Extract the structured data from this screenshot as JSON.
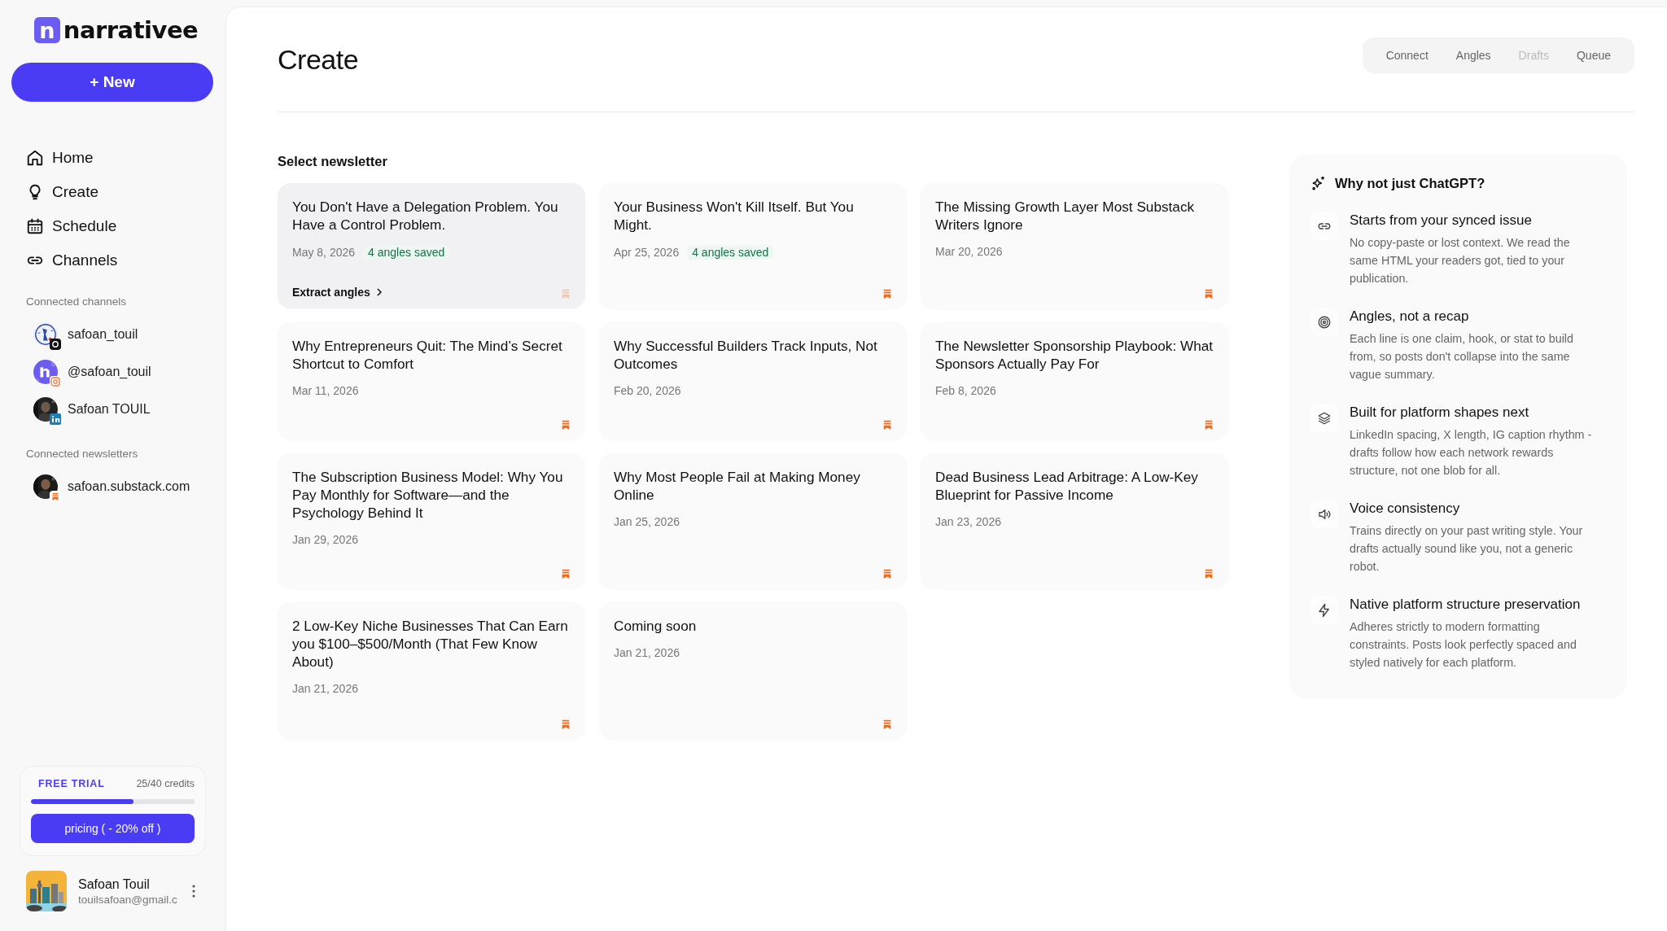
{
  "sidebar": {
    "logo_mark": "n",
    "logo_text": "narrativee",
    "new_button": "+ New",
    "nav": [
      {
        "label": "Home"
      },
      {
        "label": "Create"
      },
      {
        "label": "Schedule"
      },
      {
        "label": "Channels"
      }
    ],
    "channels_heading": "Connected channels",
    "channels": [
      {
        "name": "safoan_touil",
        "kind": "threads"
      },
      {
        "name": "@safoan_touil",
        "kind": "instagram"
      },
      {
        "name": "Safoan TOUIL",
        "kind": "linkedin"
      }
    ],
    "newsletters_heading": "Connected newsletters",
    "newsletters": [
      {
        "name": "safoan.substack.com",
        "kind": "substack"
      }
    ],
    "trial": {
      "badge": "FREE TRIAL",
      "credits": "25/40 credits",
      "level": 0.625,
      "button": "pricing ( - 20% off )"
    },
    "user": {
      "name": "Safoan Touil",
      "email": "touilsafoan@gmail.c"
    }
  },
  "main": {
    "title": "Create",
    "tabs": [
      {
        "label": "Connect",
        "disabled": false
      },
      {
        "label": "Angles",
        "disabled": false
      },
      {
        "label": "Drafts",
        "disabled": true
      },
      {
        "label": "Queue",
        "disabled": false
      }
    ],
    "section_label": "Select newsletter",
    "cards": [
      {
        "title": "You Don't Have a Delegation Problem. You Have a Control Problem.",
        "date": "May 8, 2026",
        "saved": "4 angles saved",
        "selected": true,
        "action": "Extract angles"
      },
      {
        "title": "Your Business Won't Kill Itself. But You Might.",
        "date": "Apr 25, 2026",
        "saved": "4 angles saved",
        "selected": false
      },
      {
        "title": "The Missing Growth Layer Most Substack Writers Ignore",
        "date": "Mar 20, 2026",
        "selected": false
      },
      {
        "title": "Why Entrepreneurs Quit: The Mind’s Secret Shortcut to Comfort",
        "date": "Mar 11, 2026",
        "selected": false
      },
      {
        "title": "Why Successful Builders Track Inputs, Not Outcomes",
        "date": "Feb 20, 2026",
        "selected": false
      },
      {
        "title": "The Newsletter Sponsorship Playbook: What Sponsors Actually Pay For",
        "date": "Feb 8, 2026",
        "selected": false
      },
      {
        "title": "The Subscription Business Model: Why You Pay Monthly for Software—and the Psychology Behind It",
        "date": "Jan 29, 2026",
        "selected": false
      },
      {
        "title": "Why Most People Fail at Making Money Online",
        "date": "Jan 25, 2026",
        "selected": false
      },
      {
        "title": "Dead Business Lead Arbitrage: A Low-Key Blueprint for Passive Income",
        "date": "Jan 23, 2026",
        "selected": false
      },
      {
        "title": "2 Low-Key Niche Businesses That Can Earn you $100–$500/Month (That Few Know About)",
        "date": "Jan 21, 2026",
        "selected": false
      },
      {
        "title": "Coming soon",
        "date": "Jan 21, 2026",
        "selected": false
      }
    ],
    "why": {
      "title": "Why not just ChatGPT?",
      "items": [
        {
          "title": "Starts from your synced issue",
          "text": "No copy-paste or lost context. We read the same HTML your readers got, tied to your publication."
        },
        {
          "title": "Angles, not a recap",
          "text": "Each line is one claim, hook, or stat to build from, so posts don't collapse into the same vague summary."
        },
        {
          "title": "Built for platform shapes next",
          "text": "LinkedIn spacing, X length, IG caption rhythm - drafts follow how each network rewards structure, not one blob for all."
        },
        {
          "title": "Voice consistency",
          "text": "Trains directly on your past writing style. Your drafts actually sound like you, not a generic robot."
        },
        {
          "title": "Native platform structure preservation",
          "text": "Adheres strictly to modern formatting constraints. Posts look perfectly spaced and styled natively for each platform."
        }
      ]
    }
  }
}
